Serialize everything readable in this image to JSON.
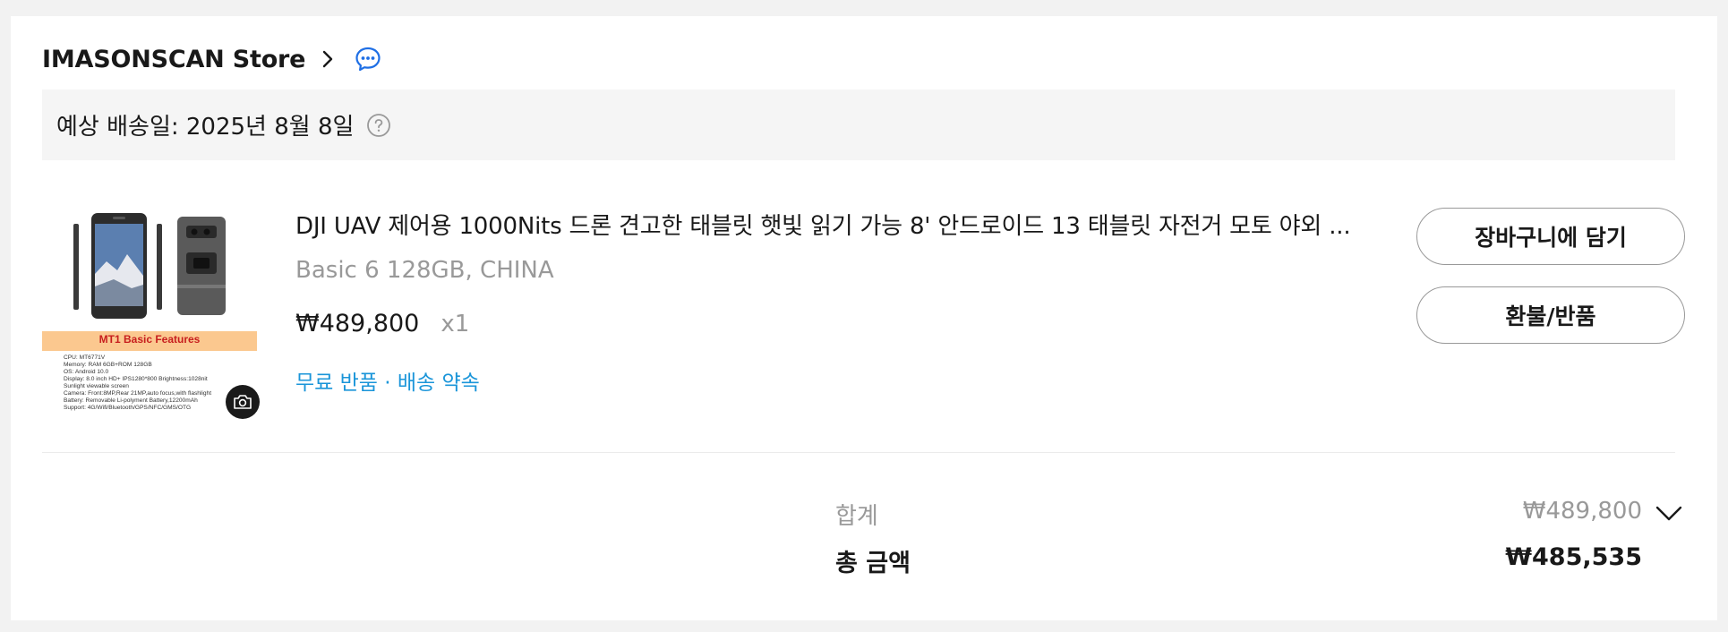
{
  "store": {
    "name": "IMASONSCAN Store",
    "chevron_icon": "chevron-right-icon",
    "chat_icon": "chat-bubble-icon"
  },
  "delivery": {
    "text": "예상 배송일: 2025년 8월 8일",
    "help_icon": "question-circle-icon"
  },
  "product": {
    "title": "DJI UAV 제어용 1000Nits 드론 견고한 태블릿 햇빛 읽기 가능 8' 안드로이드 13 태블릿 자전거 모토 야외 ...",
    "option": "Basic 6 128GB, CHINA",
    "price": "₩489,800",
    "quantity": "x1",
    "free_return": "무료 반품 · 배송 약속",
    "image": {
      "features_title": "MT1 Basic Features",
      "specs": [
        "CPU: MT6771V",
        "Memory: RAM 6GB+ROM 128GB",
        "OS: Android 10.0",
        "Display: 8.0 inch HD+ IPS1280*800 Brightness:1028nit",
        "Sunlight viewable screen",
        "Camera: Front:8MP,Rear 21MP,auto focus,with flashlight",
        "Battery: Removable Li-polyment Battery,12200mAh",
        "Support: 4G/Wifi/Bluetooth/GPS/NFC/GMS/OTG"
      ],
      "camera_icon": "camera-icon"
    }
  },
  "actions": {
    "add_to_cart": "장바구니에 담기",
    "refund_return": "환불/반품"
  },
  "summary": {
    "subtotal_label": "합계",
    "subtotal_value": "₩489,800",
    "expand_icon": "chevron-down-icon",
    "total_label": "총 금액",
    "total_value": "₩485,535"
  },
  "colors": {
    "link_blue": "#1a95d9",
    "chat_blue": "#1f6fe5",
    "muted_gray": "#999999",
    "band_orange": "#fbc88f",
    "features_red": "#c71e1e"
  }
}
